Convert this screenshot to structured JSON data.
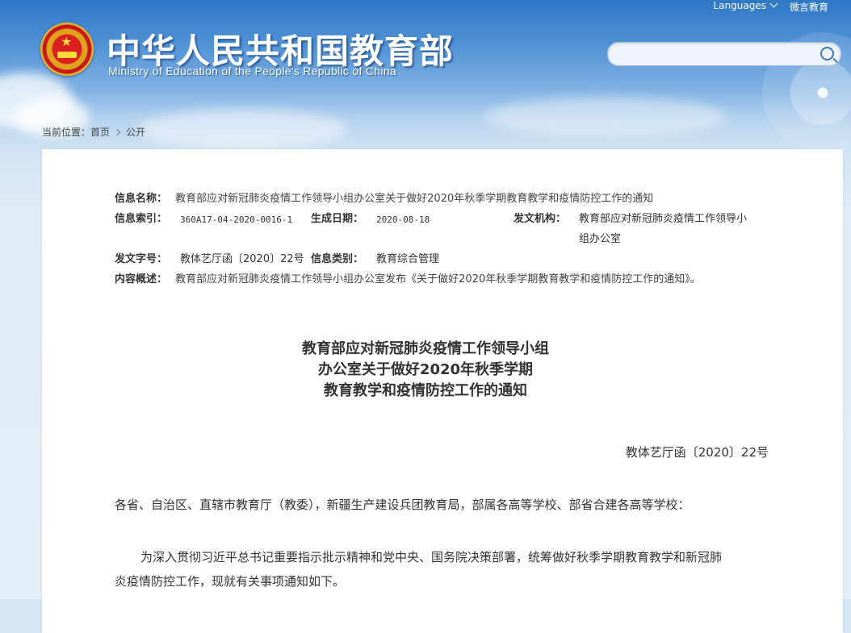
{
  "header": {
    "languages": "Languages",
    "weibo": "微言教育",
    "title_cn": "中华人民共和国教育部",
    "title_en": "Ministry of Education of the People's Republic of China",
    "search_placeholder": ""
  },
  "breadcrumb": {
    "prefix": "当前位置：",
    "home": "首页",
    "current": "公开"
  },
  "meta": {
    "name_label": "信息名称：",
    "name_value": "教育部应对新冠肺炎疫情工作领导小组办公室关于做好2020年秋季学期教育教学和疫情防控工作的通知",
    "index_label": "信息索引：",
    "index_value": "360A17-04-2020-0016-1",
    "date_label": "生成日期：",
    "date_value": "2020-08-18",
    "org_label": "发文机构：",
    "org_value_line1": "教育部应对新冠肺炎疫情工作领导小",
    "org_value_line2": "组办公室",
    "docno_label": "发文字号：",
    "docno_value": "教体艺厅函〔2020〕22号",
    "category_label": "信息类别：",
    "category_value": "教育综合管理",
    "summary_label": "内容概述：",
    "summary_value": "教育部应对新冠肺炎疫情工作领导小组办公室发布《关于做好2020年秋季学期教育教学和疫情防控工作的通知》。"
  },
  "document": {
    "title_line1": "教育部应对新冠肺炎疫情工作领导小组",
    "title_line2": "办公室关于做好2020年秋季学期",
    "title_line3": "教育教学和疫情防控工作的通知",
    "doc_number": "教体艺厅函〔2020〕22号",
    "salutation": "各省、自治区、直辖市教育厅（教委），新疆生产建设兵团教育局，部属各高等学校、部省合建各高等学校：",
    "para1_line1": "为深入贯彻习近平总书记重要指示批示精神和党中央、国务院决策部署，统筹做好秋季学期教育教学和新冠肺",
    "para1_line2": "炎疫情防控工作，现就有关事项通知如下。"
  }
}
